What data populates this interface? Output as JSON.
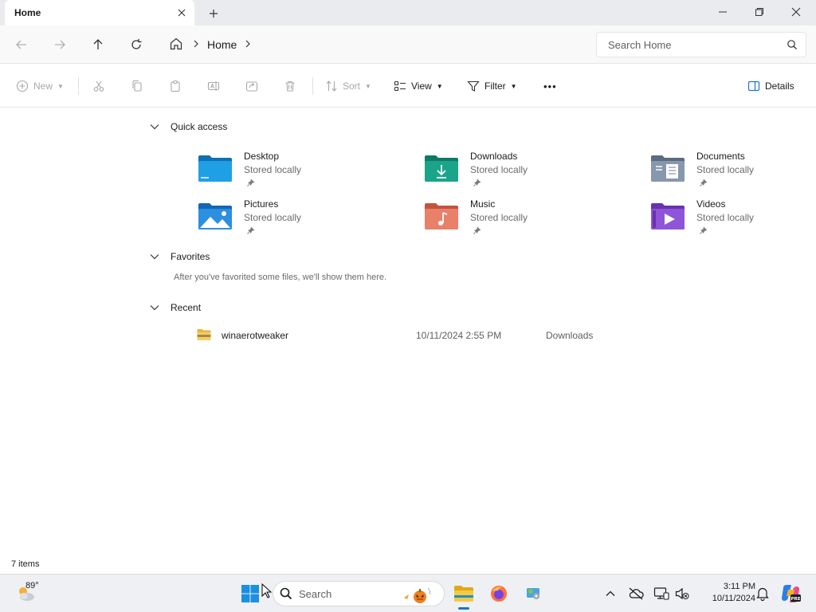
{
  "window": {
    "tab_title": "Home",
    "new_tab_symbol": "+"
  },
  "address": {
    "crumbs": [
      "Home"
    ],
    "search_placeholder": "Search Home"
  },
  "commands": {
    "new": "New",
    "sort": "Sort",
    "view": "View",
    "filter": "Filter",
    "more": "•••",
    "details": "Details"
  },
  "sections": {
    "quick_access": "Quick access",
    "favorites": "Favorites",
    "favorites_empty": "After you've favorited some files, we'll show them here.",
    "recent": "Recent"
  },
  "quick_access_items": [
    {
      "name": "Desktop",
      "status": "Stored locally",
      "icon": "desktop-folder-icon"
    },
    {
      "name": "Downloads",
      "status": "Stored locally",
      "icon": "downloads-folder-icon"
    },
    {
      "name": "Documents",
      "status": "Stored locally",
      "icon": "documents-folder-icon"
    },
    {
      "name": "Pictures",
      "status": "Stored locally",
      "icon": "pictures-folder-icon"
    },
    {
      "name": "Music",
      "status": "Stored locally",
      "icon": "music-folder-icon"
    },
    {
      "name": "Videos",
      "status": "Stored locally",
      "icon": "videos-folder-icon"
    }
  ],
  "recent_items": [
    {
      "name": "winaerotweaker",
      "date": "10/11/2024 2:55 PM",
      "location": "Downloads"
    }
  ],
  "status": {
    "item_count": "7 items"
  },
  "taskbar": {
    "weather_temp": "89°",
    "search_label": "Search",
    "time": "3:11 PM",
    "date": "10/11/2024"
  },
  "colors": {
    "accent": "#1874d0",
    "desktop": "#1a8fd6",
    "downloads": "#1aa58a",
    "documents": "#7d8fa6",
    "pictures": "#2c8fe0",
    "music": "#e2735c",
    "videos": "#8a4fd0"
  }
}
